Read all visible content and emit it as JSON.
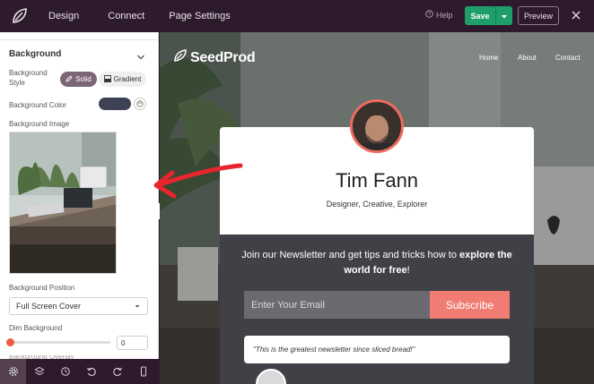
{
  "topbar": {
    "nav": [
      "Design",
      "Connect",
      "Page Settings"
    ],
    "help_label": "Help",
    "save_label": "Save",
    "preview_label": "Preview",
    "icons": [
      "seedprod-logo-icon",
      "help-icon",
      "chevron-down-icon",
      "close-icon"
    ]
  },
  "panel": {
    "section_title": "Background",
    "bg_style_label": "Background Style",
    "style_options": [
      "Solid",
      "Gradient"
    ],
    "style_selected": "Solid",
    "bg_color_label": "Background Color",
    "bg_color": "#3d4354",
    "bg_image_label": "Background Image",
    "bg_position_label": "Background Position",
    "bg_position_value": "Full Screen Cover",
    "dim_label": "Dim Background",
    "dim_value": "0",
    "dim_fraction": 0,
    "cut_label": "Background Overlay"
  },
  "toolbar": {
    "icons": [
      "settings-icon",
      "layers-icon",
      "history-icon",
      "undo-icon",
      "redo-icon",
      "mobile-preview-icon"
    ],
    "active_index": 0
  },
  "canvas": {
    "brand": "SeedProd",
    "menu": [
      "Home",
      "About",
      "Contact"
    ],
    "name": "Tim Fann",
    "tagline": "Designer, Creative, Explorer",
    "promo_text": "Join our Newsletter and get tips and tricks how to ",
    "promo_bold": "explore the world for free",
    "promo_end": "!",
    "email_placeholder": "Enter Your Email",
    "subscribe_label": "Subscribe",
    "quote": "\"This is the greatest newsletter since sliced bread!\""
  },
  "colors": {
    "topbar": "#2e1a2d",
    "save": "#1e9e68",
    "accent": "#ef5a40",
    "subscribe": "#f07c73",
    "avatar_ring": "#f06b5f",
    "card_dark": "#404047",
    "arrow": "#e8252d"
  }
}
